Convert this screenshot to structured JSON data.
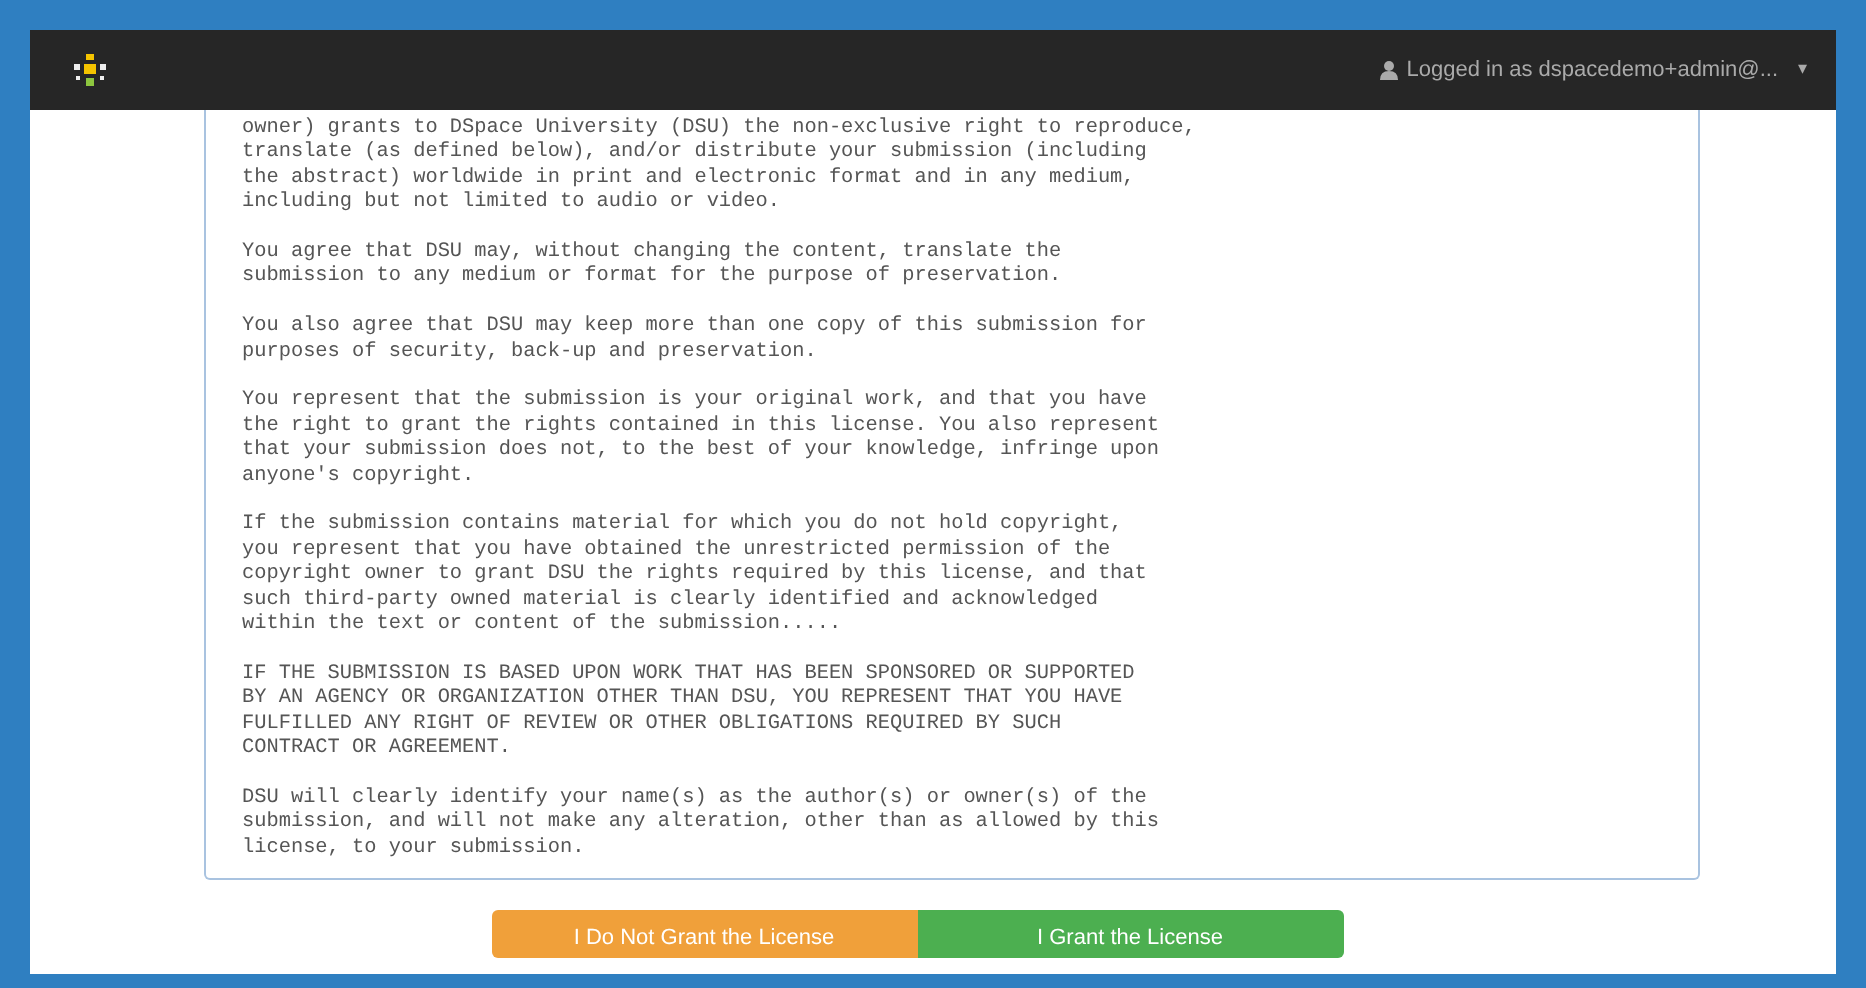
{
  "navbar": {
    "user_label": "Logged in as dspacedemo+admin@...",
    "caret": "▾"
  },
  "license": {
    "paragraphs": [
      "owner) grants to DSpace University (DSU) the non-exclusive right to reproduce,\ntranslate (as defined below), and/or distribute your submission (including\nthe abstract) worldwide in print and electronic format and in any medium,\nincluding but not limited to audio or video.",
      "You agree that DSU may, without changing the content, translate the\nsubmission to any medium or format for the purpose of preservation.",
      "You also agree that DSU may keep more than one copy of this submission for\npurposes of security, back-up and preservation.",
      "You represent that the submission is your original work, and that you have\nthe right to grant the rights contained in this license. You also represent\nthat your submission does not, to the best of your knowledge, infringe upon\nanyone's copyright.",
      "If the submission contains material for which you do not hold copyright,\nyou represent that you have obtained the unrestricted permission of the\ncopyright owner to grant DSU the rights required by this license, and that\nsuch third-party owned material is clearly identified and acknowledged\nwithin the text or content of the submission.....",
      "IF THE SUBMISSION IS BASED UPON WORK THAT HAS BEEN SPONSORED OR SUPPORTED\nBY AN AGENCY OR ORGANIZATION OTHER THAN DSU, YOU REPRESENT THAT YOU HAVE\nFULFILLED ANY RIGHT OF REVIEW OR OTHER OBLIGATIONS REQUIRED BY SUCH\nCONTRACT OR AGREEMENT.",
      "DSU will clearly identify your name(s) as the author(s) or owner(s) of the\nsubmission, and will not make any alteration, other than as allowed by this\nlicense, to your submission."
    ]
  },
  "buttons": [
    {
      "label": "I Do Not Grant the License",
      "kind": "decline"
    },
    {
      "label": "I Grant the License",
      "kind": "grant"
    }
  ]
}
